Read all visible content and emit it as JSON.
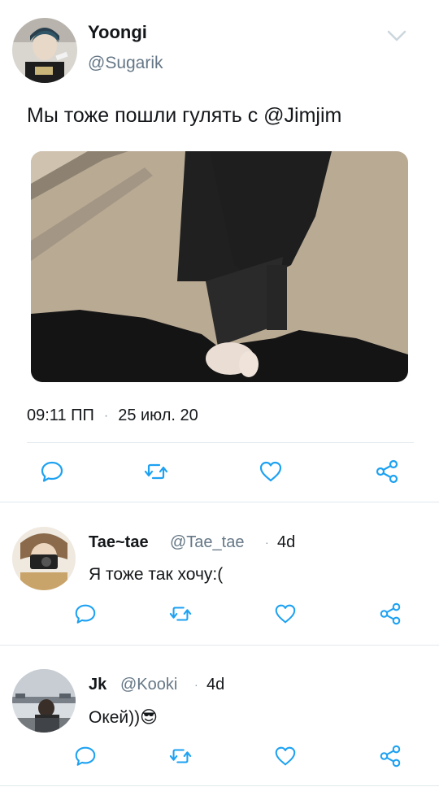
{
  "tweet": {
    "name": "Yoongi",
    "handle": "@Sugarik",
    "text": "Мы тоже пошли гулять с @Jimjim",
    "time": "09:11 ПП",
    "date": "25 июл. 20"
  },
  "replies": [
    {
      "name": "Tae~tae",
      "handle": "@Tae_tae",
      "time": "4d",
      "text": "Я тоже так хочу:("
    },
    {
      "name": "Jk",
      "handle": "@Kooki",
      "time": "4d",
      "text": "Окей))😎"
    }
  ],
  "icons": {
    "menu": "chevron-down-icon",
    "reply": "reply-icon",
    "retweet": "retweet-icon",
    "like": "like-icon",
    "share": "share-icon"
  },
  "colors": {
    "icon": "#1da1f2",
    "secondary_text": "#657786",
    "divider": "#e1e8ed"
  }
}
